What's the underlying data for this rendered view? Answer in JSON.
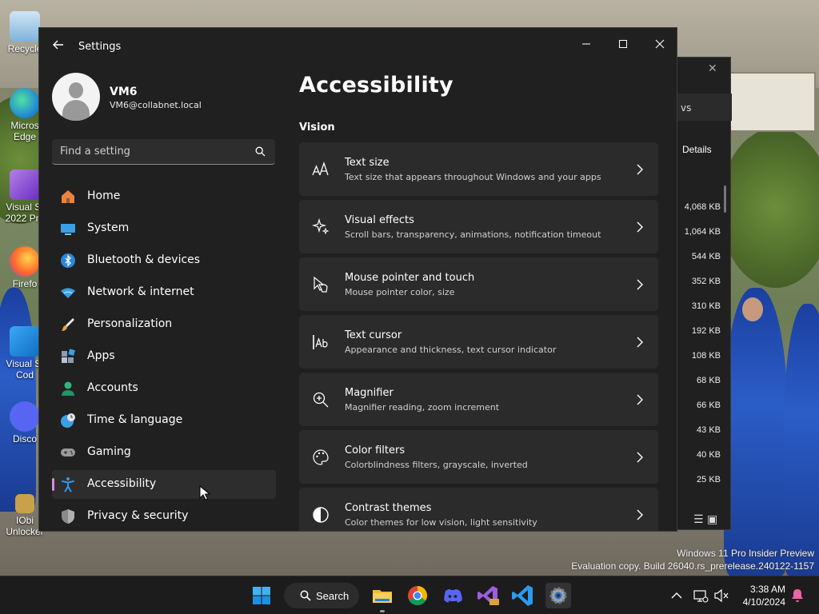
{
  "desktop": {
    "icons": [
      {
        "label": "Recycle",
        "icon": "recycle-bin-icon"
      },
      {
        "label": "Micros Edge",
        "icon": "edge-icon"
      },
      {
        "label": "Visual St 2022 Pre",
        "icon": "visual-studio-icon"
      },
      {
        "label": "Firefo",
        "icon": "firefox-icon"
      },
      {
        "label": "Visual St Cod",
        "icon": "vscode-icon"
      },
      {
        "label": "Disco",
        "icon": "discord-icon"
      },
      {
        "label": "IObi Unlocker",
        "icon": "iobit-unlocker-icon"
      }
    ],
    "watermark": {
      "line1": "Windows 11 Pro Insider Preview",
      "line2": "Evaluation copy. Build 26040.rs_prerelease.240122-1157"
    }
  },
  "background_window": {
    "tab_text": "vs",
    "details_label": "Details",
    "sizes": [
      "4,068 KB",
      "1,064 KB",
      "544 KB",
      "352 KB",
      "310 KB",
      "192 KB",
      "108 KB",
      "68 KB",
      "66 KB",
      "43 KB",
      "40 KB",
      "25 KB"
    ]
  },
  "settings": {
    "title": "Settings",
    "user": {
      "name": "VM6",
      "email": "VM6@collabnet.local"
    },
    "search_placeholder": "Find a setting",
    "nav": [
      {
        "label": "Home",
        "icon": "home-icon",
        "color": "#e8843c"
      },
      {
        "label": "System",
        "icon": "system-icon",
        "color": "#3aa0e6"
      },
      {
        "label": "Bluetooth & devices",
        "icon": "bluetooth-icon",
        "color": "#2b88d8"
      },
      {
        "label": "Network & internet",
        "icon": "network-icon",
        "color": "#3aa0e6"
      },
      {
        "label": "Personalization",
        "icon": "paintbrush-icon",
        "color": "#e6a34f"
      },
      {
        "label": "Apps",
        "icon": "apps-icon",
        "color": "#8a9bb5"
      },
      {
        "label": "Accounts",
        "icon": "accounts-icon",
        "color": "#2fb47c"
      },
      {
        "label": "Time & language",
        "icon": "globe-clock-icon",
        "color": "#3aa0e6"
      },
      {
        "label": "Gaming",
        "icon": "gamepad-icon",
        "color": "#9a9a9a"
      },
      {
        "label": "Accessibility",
        "icon": "accessibility-icon",
        "color": "#2b9bf4",
        "active": true
      },
      {
        "label": "Privacy & security",
        "icon": "shield-icon",
        "color": "#8a8a8a"
      }
    ],
    "page_title": "Accessibility",
    "section": "Vision",
    "cards": [
      {
        "title": "Text size",
        "subtitle": "Text size that appears throughout Windows and your apps",
        "icon": "text-size-icon"
      },
      {
        "title": "Visual effects",
        "subtitle": "Scroll bars, transparency, animations, notification timeout",
        "icon": "sparkle-icon"
      },
      {
        "title": "Mouse pointer and touch",
        "subtitle": "Mouse pointer color, size",
        "icon": "pointer-icon"
      },
      {
        "title": "Text cursor",
        "subtitle": "Appearance and thickness, text cursor indicator",
        "icon": "text-cursor-icon"
      },
      {
        "title": "Magnifier",
        "subtitle": "Magnifier reading, zoom increment",
        "icon": "magnifier-icon"
      },
      {
        "title": "Color filters",
        "subtitle": "Colorblindness filters, grayscale, inverted",
        "icon": "palette-icon"
      },
      {
        "title": "Contrast themes",
        "subtitle": "Color themes for low vision, light sensitivity",
        "icon": "contrast-icon"
      }
    ]
  },
  "taskbar": {
    "search_label": "Search",
    "time": "3:38 AM",
    "date": "4/10/2024"
  }
}
